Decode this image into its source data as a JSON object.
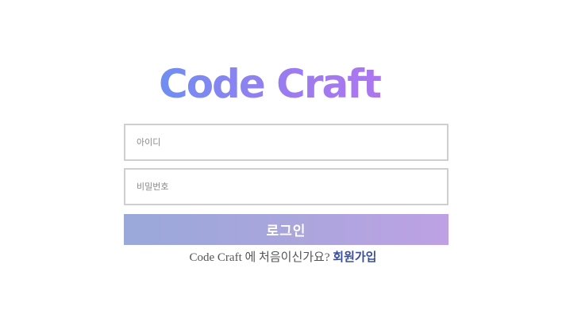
{
  "logo": {
    "text": "Code Craft"
  },
  "form": {
    "id_placeholder": "아이디",
    "id_value": "",
    "password_placeholder": "비밀번호",
    "password_value": "",
    "login_label": "로그인"
  },
  "signup": {
    "prompt": "Code Craft 에 처음이신가요? ",
    "link_label": "회원가입"
  },
  "colors": {
    "logo_gradient_start": "#6f8ef2",
    "logo_gradient_end": "#b075ef",
    "button_gradient_start": "#9aa8da",
    "button_gradient_end": "#bea1e4",
    "link": "#3a4f9a",
    "border": "#cfcfcf"
  }
}
